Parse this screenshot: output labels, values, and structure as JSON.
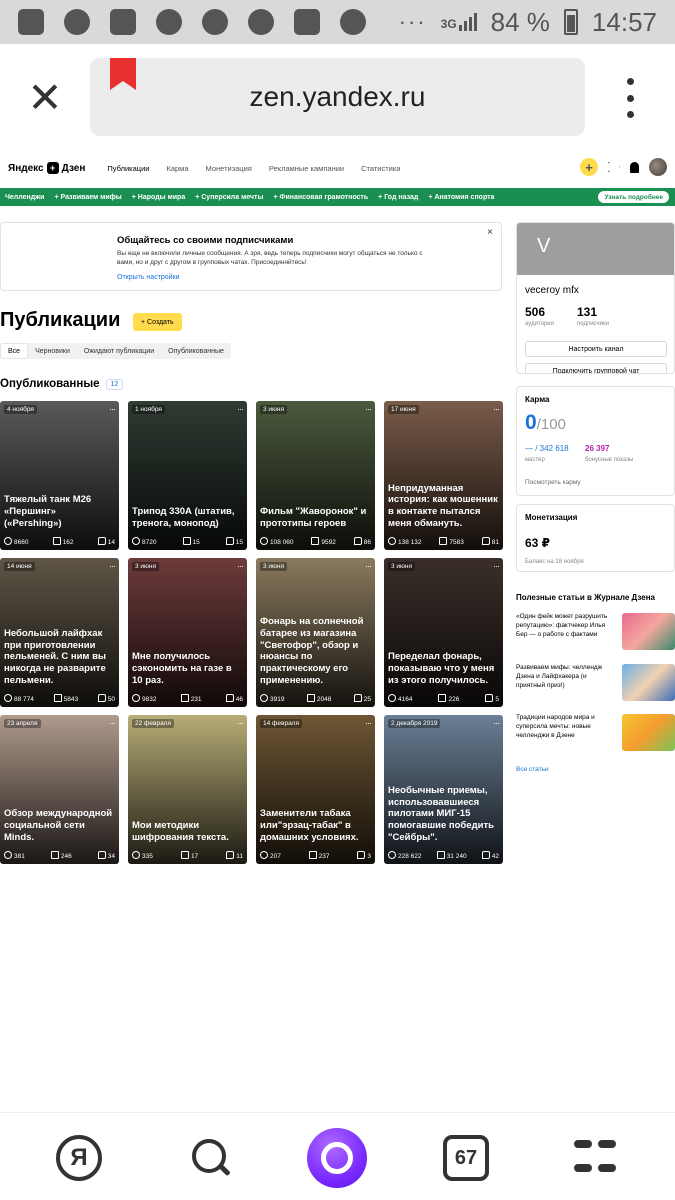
{
  "status_bar": {
    "network": "3G",
    "battery": "84 %",
    "time": "14:57",
    "dots": "···"
  },
  "browser": {
    "url": "zen.yandex.ru"
  },
  "nav": {
    "logo": "Яндекс",
    "logo_suffix": "Дзен",
    "links": [
      "Публикации",
      "Карма",
      "Монетизация",
      "Рекламные кампании",
      "Статистика"
    ]
  },
  "challenges": {
    "label": "Челленджи",
    "items": [
      "+ Развиваем мифы",
      "+ Народы мира",
      "+ Суперсила мечты",
      "+ Финансовая грамотность",
      "+ Год назад",
      "+ Анатомия спорта"
    ],
    "button": "Узнать подробнее"
  },
  "notice": {
    "title": "Общайтесь со своими подписчиками",
    "text": "Вы еще не включили личные сообщения. А зря, ведь теперь подписчики могут общаться не только с вами, но и друг с другом в групповых чатах. Присоединяйтесь!",
    "link": "Открыть настройки",
    "close": "×"
  },
  "publications": {
    "title": "Публикации",
    "create": "+ Создать",
    "filters": [
      "Все",
      "Черновики",
      "Ожидают публикации",
      "Опубликованные"
    ],
    "published_label": "Опубликованные",
    "published_count": "12"
  },
  "cards": [
    {
      "date": "4 ноября",
      "title": "Тяжелый танк М26 «Першинг» («Pershing»)",
      "views": "8660",
      "reads": "162",
      "comments": "14",
      "bg": "#5a5a5a"
    },
    {
      "date": "1 ноября",
      "title": "Трипод 330А (штатив, тренога, монопод)",
      "views": "8720",
      "reads": "15",
      "comments": "15",
      "bg": "#2f3b33"
    },
    {
      "date": "3 июня",
      "title": "Фильм \"Жаворонок\" и прототипы героев",
      "views": "108 060",
      "reads": "9592",
      "comments": "86",
      "bg": "#4c5a3e"
    },
    {
      "date": "17 июня",
      "title": "Непридуманная история: как мошенник в контакте пытался меня обмануть.",
      "views": "138 132",
      "reads": "7583",
      "comments": "81",
      "bg": "#7a5c4a"
    },
    {
      "date": "14 июня",
      "title": "Небольшой лайфхак при приготовлении пельменей. С ним вы никогда не разварите пельмени.",
      "views": "88 774",
      "reads": "5843",
      "comments": "50",
      "bg": "#5e5546"
    },
    {
      "date": "3 июня",
      "title": "Мне получилось сэкономить на газе в 10 раз.",
      "views": "9832",
      "reads": "231",
      "comments": "46",
      "bg": "#6d3b3b"
    },
    {
      "date": "3 июня",
      "title": "Фонарь на солнечной батарее из магазина \"Светофор\", обзор и нюансы по практическому его применению.",
      "views": "3919",
      "reads": "2048",
      "comments": "25",
      "bg": "#8a7a5e"
    },
    {
      "date": "3 июня",
      "title": "Переделал фонарь, показываю что у меня из этого получилось.",
      "views": "4164",
      "reads": "226",
      "comments": "5",
      "bg": "#3a2f2a"
    },
    {
      "date": "23 апреля",
      "title": "Обзор международной социальной сети Minds.",
      "views": "381",
      "reads": "246",
      "comments": "34",
      "bg": "#b09a8c"
    },
    {
      "date": "22 февраля",
      "title": "Мои методики шифрования текста.",
      "views": "335",
      "reads": "17",
      "comments": "11",
      "bg": "#b7ad77"
    },
    {
      "date": "14 февраля",
      "title": "Заменители табака или\"эрзац-табак\" в домашних условиях.",
      "views": "207",
      "reads": "237",
      "comments": "3",
      "bg": "#6e5634"
    },
    {
      "date": "2 декабря 2019",
      "title": "Необычные приемы, использовавшиеся пилотами МИГ-15 помогавшие победить \"Сейбры\".",
      "views": "228 622",
      "reads": "31 240",
      "comments": "42",
      "bg": "#6b7f96"
    }
  ],
  "profile": {
    "letter": "V",
    "name": "veceroy mfx",
    "audience": "506",
    "audience_label": "аудитория",
    "subscribers": "131",
    "subscribers_label": "подписчики",
    "btn_settings": "Настроить канал",
    "btn_chat": "Подключить групповой чат"
  },
  "karma": {
    "title": "Карма",
    "value": "0",
    "max": "/100",
    "master": "— / 342 618",
    "master_label": "мастер",
    "bonus": "26 397",
    "bonus_label": "бонусные показы",
    "link": "Посмотреть карму"
  },
  "money": {
    "title": "Монетизация",
    "value": "63 ₽",
    "balance": "Баланс на 18 ноября"
  },
  "journal": {
    "title": "Полезные статьи в Журнале Дзена",
    "items": [
      "«Один фейк может разрушить репутацию»: фактчекер Илья Бер — о работе с фактами",
      "Развиваем мифы: челлендж Дзена и Лайфхакера (и приятный приз!)",
      "Традиции народов мира и суперсила мечты: новые челленджи в Дзене"
    ],
    "all": "Все статьи"
  },
  "bottom": {
    "ya": "Я",
    "tabs": "67"
  },
  "colors": {
    "accent_yellow": "#ffdb4d",
    "green": "#1b8f52",
    "link_blue": "#1a73d9",
    "alice_purple": "#7a2cff"
  }
}
